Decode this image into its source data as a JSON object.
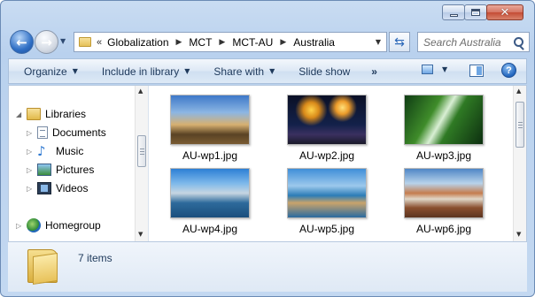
{
  "address_bar": {
    "overflow_chevron": "«",
    "breadcrumbs": [
      "Globalization",
      "MCT",
      "MCT-AU",
      "Australia"
    ],
    "separator": "▶"
  },
  "search": {
    "placeholder": "Search Australia"
  },
  "toolbar": {
    "organize": "Organize",
    "include_in_library": "Include in library",
    "share_with": "Share with",
    "slide_show": "Slide show",
    "more": "»"
  },
  "nav_pane": {
    "items": [
      {
        "label": "Libraries",
        "icon": "libraries-icon"
      },
      {
        "label": "Documents",
        "icon": "documents-icon"
      },
      {
        "label": "Music",
        "icon": "music-icon"
      },
      {
        "label": "Pictures",
        "icon": "pictures-icon"
      },
      {
        "label": "Videos",
        "icon": "videos-icon"
      },
      {
        "label": "Homegroup",
        "icon": "homegroup-icon"
      }
    ]
  },
  "files": [
    {
      "name": "AU-wp1.jpg"
    },
    {
      "name": "AU-wp2.jpg"
    },
    {
      "name": "AU-wp3.jpg"
    },
    {
      "name": "AU-wp4.jpg"
    },
    {
      "name": "AU-wp5.jpg"
    },
    {
      "name": "AU-wp6.jpg"
    }
  ],
  "details": {
    "item_count": "7 items"
  },
  "colors": {
    "accent": "#1e395b",
    "window_frame": "#c9dcf2",
    "close_button": "#c44c35"
  }
}
